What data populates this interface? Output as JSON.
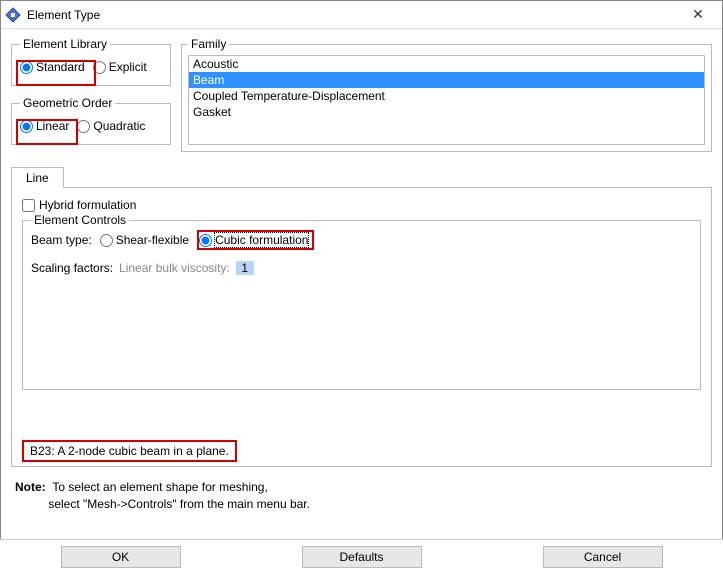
{
  "title": "Element Type",
  "element_library": {
    "legend": "Element Library",
    "standard": "Standard",
    "explicit": "Explicit"
  },
  "geometric_order": {
    "legend": "Geometric Order",
    "linear": "Linear",
    "quadratic": "Quadratic"
  },
  "family": {
    "legend": "Family",
    "items": [
      "Acoustic",
      "Beam",
      "Coupled Temperature-Displacement",
      "Gasket"
    ],
    "selected_index": 1
  },
  "tab": {
    "label": "Line"
  },
  "hybrid": {
    "label": "Hybrid formulation",
    "checked": false
  },
  "element_controls": {
    "legend": "Element Controls",
    "beam_type_label": "Beam type:",
    "shear_flexible": "Shear-flexible",
    "cubic": "Cubic formulation",
    "scaling_factors_label": "Scaling factors:",
    "linear_bulk_label": "Linear bulk viscosity:",
    "linear_bulk_value": "1"
  },
  "description": "B23:  A 2-node cubic beam in a plane.",
  "note": {
    "label": "Note:",
    "line1": "To select an element shape for meshing,",
    "line2": "select \"Mesh->Controls\" from the main menu bar."
  },
  "buttons": {
    "ok": "OK",
    "defaults": "Defaults",
    "cancel": "Cancel"
  }
}
